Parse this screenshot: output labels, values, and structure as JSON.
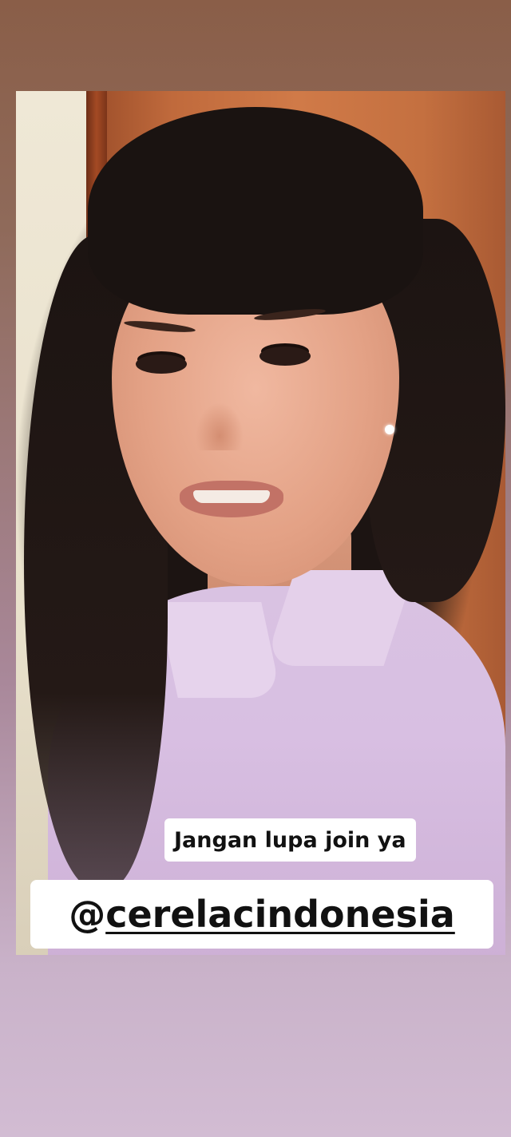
{
  "story": {
    "caption_text": "Jangan lupa join ya",
    "mention_prefix": "@",
    "mention_handle": "cerelacindonesia"
  }
}
